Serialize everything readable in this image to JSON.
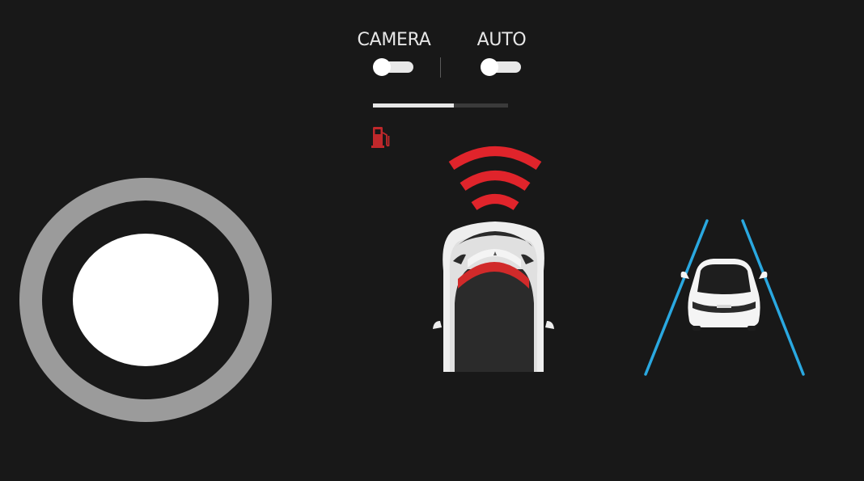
{
  "toggles": {
    "camera": {
      "label": "CAMERA",
      "on": false
    },
    "auto": {
      "label": "AUTO",
      "on": false
    }
  },
  "progress": {
    "value_percent": 60
  },
  "icons": {
    "fuel": "fuel-pump-icon",
    "proximity": "proximity-signal-icon",
    "joystick": "joystick-control",
    "car_front": "car-top-view-icon",
    "car_rear": "car-rear-view-icon",
    "lane_lines": "lane-lines-icon"
  },
  "colors": {
    "background": "#181818",
    "signal": "#e0242b",
    "fuel": "#c0282b",
    "lane": "#2aa8e0",
    "joystick_ring": "#9b9b9b",
    "joystick_knob": "#ffffff"
  }
}
